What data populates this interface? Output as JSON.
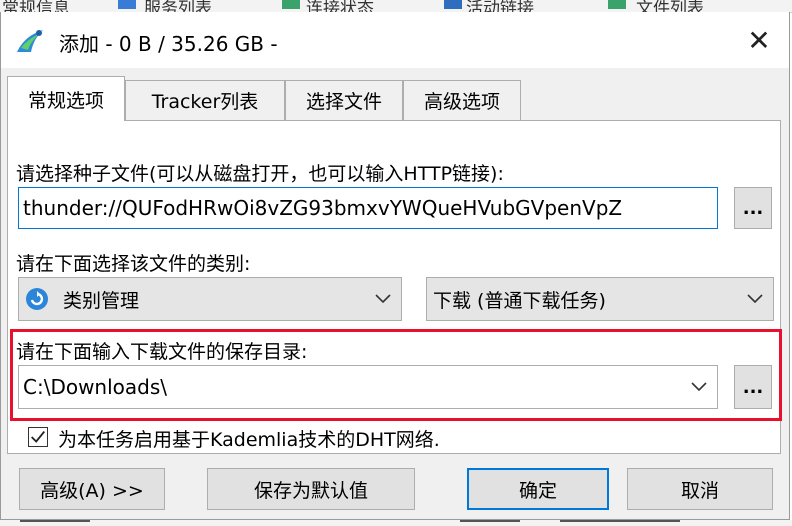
{
  "background": {
    "items": [
      "常规信息",
      "服务列表",
      "连接状态",
      "活动链接",
      "文件列表"
    ]
  },
  "window": {
    "title": "添加 - 0 B / 35.26 GB -",
    "close_label": "✕"
  },
  "tabs": [
    {
      "label": "常规选项",
      "active": true
    },
    {
      "label": "Tracker列表",
      "active": false
    },
    {
      "label": "选择文件",
      "active": false
    },
    {
      "label": "高级选项",
      "active": false
    }
  ],
  "torrent": {
    "label": "请选择种子文件(可以从磁盘打开，也可以输入HTTP链接):",
    "value": "thunder://QUFodHRwOi8vZG93bmxvYWQueHVubGVpenVpZ",
    "browse_label": "..."
  },
  "category": {
    "label": "请在下面选择该文件的类别:",
    "selected": "类别管理",
    "type_selected": "下载 (普通下载任务)"
  },
  "save_dir": {
    "label": "请在下面输入下载文件的保存目录:",
    "value": "C:\\Downloads\\",
    "browse_label": "..."
  },
  "dht": {
    "label": "为本任务启用基于Kademlia技术的DHT网络.",
    "checked": true
  },
  "buttons": {
    "advanced": "高级(A) >>",
    "save_default": "保存为默认值",
    "ok": "确定",
    "cancel": "取消"
  },
  "colors": {
    "highlight_box": "#e8112d",
    "focus_border": "#0078d7"
  }
}
